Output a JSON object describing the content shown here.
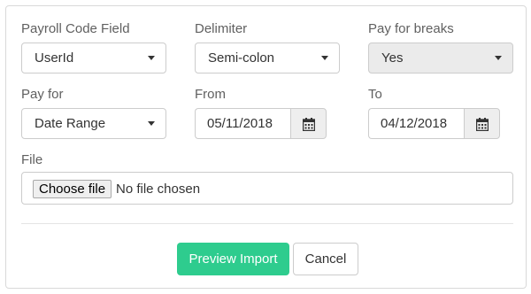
{
  "form": {
    "payroll_code_field": {
      "label": "Payroll Code Field",
      "value": "UserId"
    },
    "delimiter": {
      "label": "Delimiter",
      "value": "Semi-colon"
    },
    "pay_for_breaks": {
      "label": "Pay for breaks",
      "value": "Yes"
    },
    "pay_for": {
      "label": "Pay for",
      "value": "Date Range"
    },
    "from": {
      "label": "From",
      "value": "05/11/2018"
    },
    "to": {
      "label": "To",
      "value": "04/12/2018"
    },
    "file": {
      "label": "File",
      "button_label": "Choose file",
      "status": "No file chosen"
    }
  },
  "actions": {
    "preview_label": "Preview Import",
    "cancel_label": "Cancel"
  },
  "icons": {
    "dropdown": "caret-down-icon",
    "calendar": "calendar-icon"
  },
  "colors": {
    "primary": "#2ecc8e",
    "disabled_bg": "#ebebeb",
    "addon_bg": "#eeeeee",
    "border": "#cccccc"
  }
}
